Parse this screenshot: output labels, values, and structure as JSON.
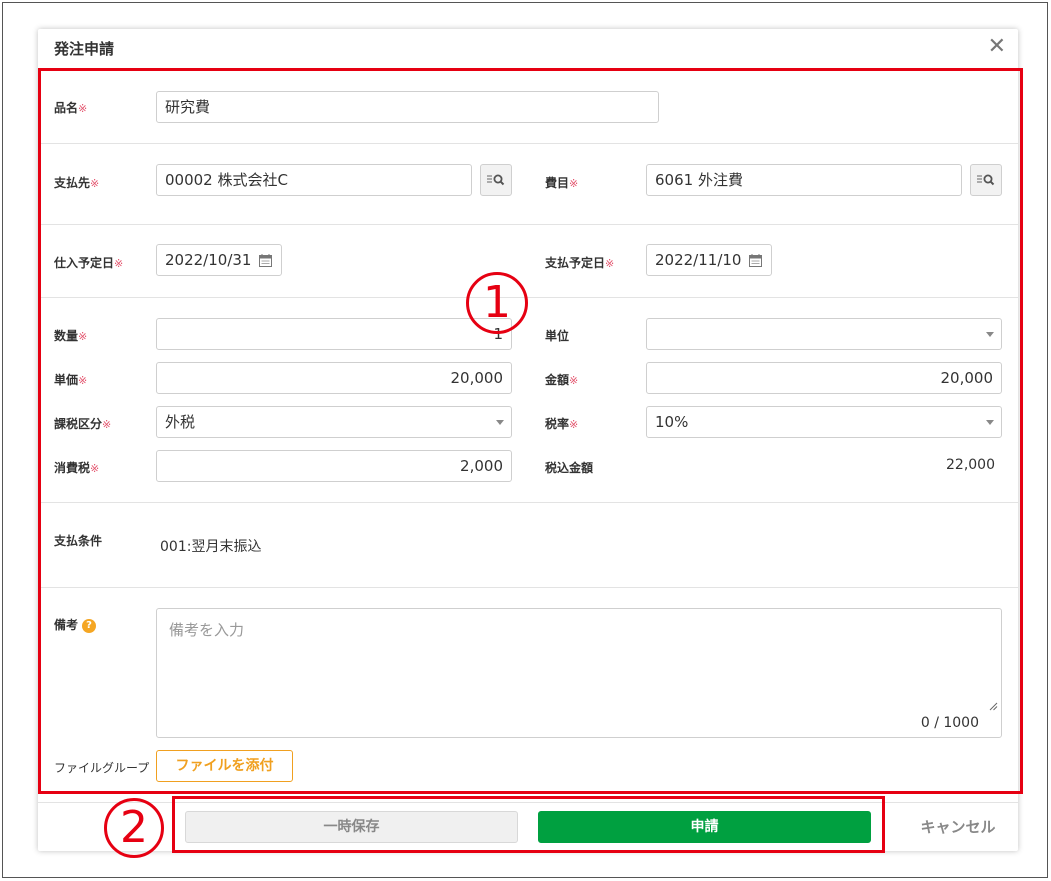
{
  "dialog": {
    "title": "発注申請",
    "close_glyph": "✕"
  },
  "required_mark": "※",
  "fields": {
    "item_name": {
      "label": "品名",
      "value": "研究費"
    },
    "payee": {
      "label": "支払先",
      "value": "00002 株式会社C"
    },
    "expense": {
      "label": "費目",
      "value": "6061 外注費"
    },
    "purchase_date": {
      "label": "仕入予定日",
      "value": "2022/10/31"
    },
    "payment_date": {
      "label": "支払予定日",
      "value": "2022/11/10"
    },
    "quantity": {
      "label": "数量",
      "value": "1"
    },
    "unit": {
      "label": "単位",
      "value": ""
    },
    "unit_price": {
      "label": "単価",
      "value": "20,000"
    },
    "amount": {
      "label": "金額",
      "value": "20,000"
    },
    "tax_category": {
      "label": "課税区分",
      "value": "外税"
    },
    "tax_rate": {
      "label": "税率",
      "value": "10%"
    },
    "consumption_tax": {
      "label": "消費税",
      "value": "2,000"
    },
    "total_with_tax": {
      "label": "税込金額",
      "value": "22,000"
    },
    "payment_terms": {
      "label": "支払条件",
      "value": "001:翌月末振込"
    },
    "remarks": {
      "label": "備考",
      "placeholder": "備考を入力",
      "counter": "0 / 1000",
      "help": "?"
    },
    "file_group": {
      "label": "ファイルグループ",
      "button": "ファイルを添付"
    }
  },
  "footer": {
    "save_draft": "一時保存",
    "apply": "申請",
    "cancel": "キャンセル"
  },
  "annotations": {
    "marker_1": "①",
    "marker_2": "②"
  },
  "colors": {
    "accent_red": "#e60012",
    "apply_green": "#00a040",
    "file_orange": "#f0a020",
    "required_pink": "#e4566f"
  }
}
